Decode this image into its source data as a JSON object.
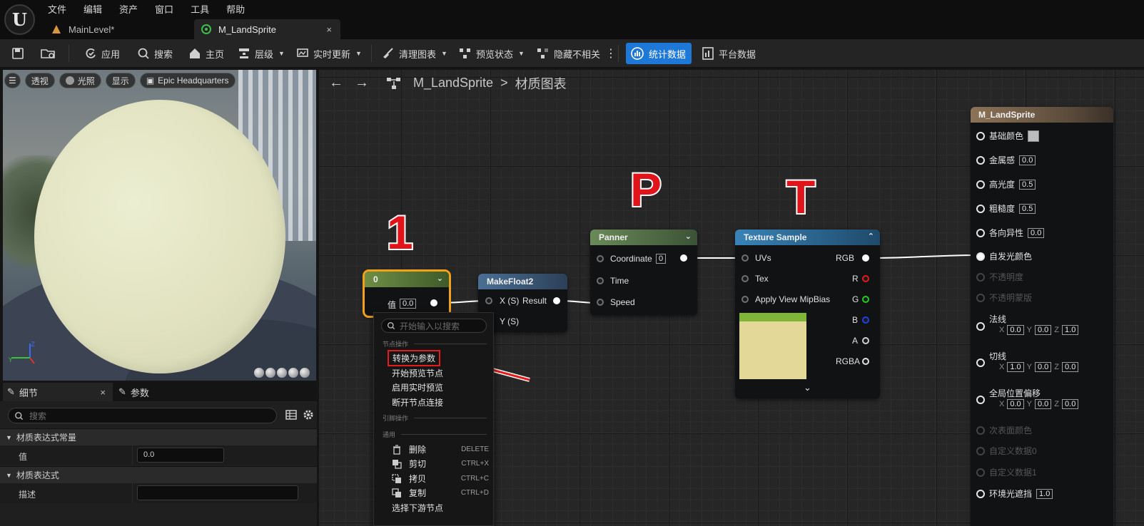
{
  "menu": [
    "文件",
    "编辑",
    "资产",
    "窗口",
    "工具",
    "帮助"
  ],
  "tabs": [
    {
      "label": "MainLevel*"
    },
    {
      "label": "M_LandSprite",
      "close": "×"
    }
  ],
  "toolbar": {
    "apply": "应用",
    "search": "搜索",
    "home": "主页",
    "hierarchy": "层级",
    "live_update": "实时更新",
    "clean_graph": "清理图表",
    "preview_state": "预览状态",
    "hide_unrelated": "隐藏不相关",
    "stats": "统计数据",
    "platform_stats": "平台数据"
  },
  "viewport": {
    "perspective": "透视",
    "lighting": "光照",
    "show": "显示",
    "level": "Epic Headquarters"
  },
  "details": {
    "tab_details": "细节",
    "tab_params": "参数",
    "tab_close": "×",
    "search_placeholder": "搜索",
    "section_constant": "材质表达式常量",
    "value_label": "值",
    "value": "0.0",
    "section_expression": "材质表达式",
    "desc_label": "描述",
    "desc_value": ""
  },
  "graph": {
    "breadcrumb_material": "M_LandSprite",
    "breadcrumb_sep": ">",
    "breadcrumb_graph": "材质图表",
    "annotations": {
      "one": "1",
      "p": "P",
      "t": "T"
    },
    "constant_node": {
      "title": "0",
      "value_label": "值",
      "value": "0.0"
    },
    "makefloat2": {
      "title": "MakeFloat2",
      "x": "X (S)",
      "y": "Y (S)",
      "result": "Result"
    },
    "panner": {
      "title": "Panner",
      "coordinate": "Coordinate",
      "coord_value": "0",
      "time": "Time",
      "speed": "Speed"
    },
    "texture_sample": {
      "title": "Texture Sample",
      "uvs": "UVs",
      "tex": "Tex",
      "mipbias": "Apply View MipBias",
      "rgb": "RGB",
      "r": "R",
      "g": "G",
      "b": "B",
      "a": "A",
      "rgba": "RGBA"
    },
    "output": {
      "title": "M_LandSprite",
      "base_color": "基础颜色",
      "metallic": "金属感",
      "metallic_v": "0.0",
      "specular": "高光度",
      "specular_v": "0.5",
      "roughness": "粗糙度",
      "roughness_v": "0.5",
      "anisotropy": "各向异性",
      "anisotropy_v": "0.0",
      "emissive": "自发光颜色",
      "opacity": "不透明度",
      "opacity_mask": "不透明蒙版",
      "normal": "法线",
      "normal_x": "0.0",
      "normal_y": "0.0",
      "normal_z": "1.0",
      "tangent": "切线",
      "tangent_x": "1.0",
      "tangent_y": "0.0",
      "tangent_z": "0.0",
      "wpo": "全局位置偏移",
      "wpo_x": "0.0",
      "wpo_y": "0.0",
      "wpo_z": "0.0",
      "subsurface": "次表面颜色",
      "custom0": "自定义数据0",
      "custom1": "自定义数据1",
      "ao": "环境光遮挡",
      "ao_v": "1.0",
      "axis_x": "X",
      "axis_y": "Y",
      "axis_z": "Z"
    }
  },
  "context_menu": {
    "search_placeholder": "开始输入以搜索",
    "section_node": "节点操作",
    "convert": "转换为参数",
    "start_preview": "开始预览节点",
    "enable_live": "启用实时预览",
    "break_links": "断开节点连接",
    "section_pin": "引脚操作",
    "section_general": "通用",
    "delete": "删除",
    "delete_sc": "DELETE",
    "cut": "剪切",
    "cut_sc": "CTRL+X",
    "copy": "拷贝",
    "copy_sc": "CTRL+C",
    "duplicate": "复制",
    "duplicate_sc": "CTRL+D",
    "select_downstream": "选择下游节点"
  },
  "colors": {
    "accent": "#1e78d7",
    "highlight": "#e41c1c",
    "constant_header": "#5c7a3a",
    "function_header": "#3c5a78",
    "panner_header": "#5b7a4b",
    "texture_header": "#2a6a9a"
  }
}
